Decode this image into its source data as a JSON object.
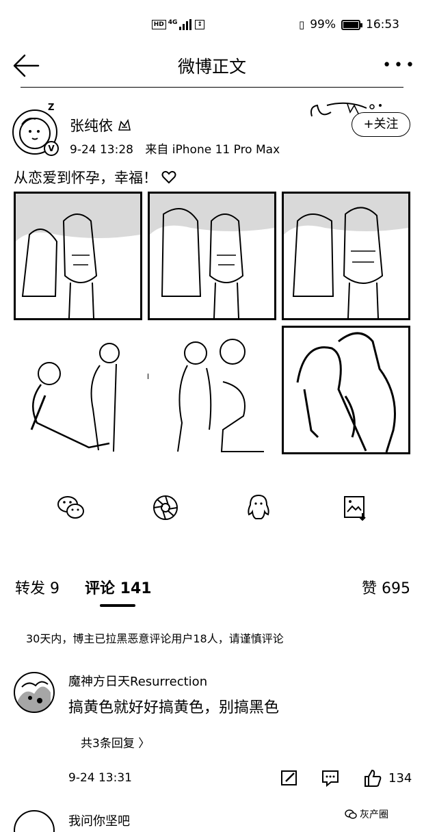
{
  "status_bar": {
    "network": "4G",
    "hd": "HD",
    "battery": "99%",
    "battery_level": 0.99,
    "time": "16:53"
  },
  "nav": {
    "title": "微博正文"
  },
  "post": {
    "author": "张纯依",
    "date": "9-24 13:28",
    "source": "来自 iPhone 11 Pro Max",
    "follow_label": "+关注",
    "text": "从恋爱到怀孕，幸福！",
    "avatar_zz": "Z"
  },
  "share": {
    "icons": [
      "wechat-icon",
      "moments-icon",
      "qq-icon",
      "save-image-icon"
    ]
  },
  "tabs": {
    "repost": "转发 9",
    "comments": "评论 141",
    "likes": "赞 695"
  },
  "notice": "30天内，博主已拉黑恶意评论用户18人，请谨慎评论",
  "comment": {
    "user": "魔神方日天Resurrection",
    "text": "搞黄色就好好搞黄色，别搞黑色",
    "replies": "共3条回复 〉",
    "time": "9-24 13:31",
    "likes": "134"
  },
  "next_comment": {
    "text": "我问你坚吧"
  },
  "watermark": "灰产圈"
}
